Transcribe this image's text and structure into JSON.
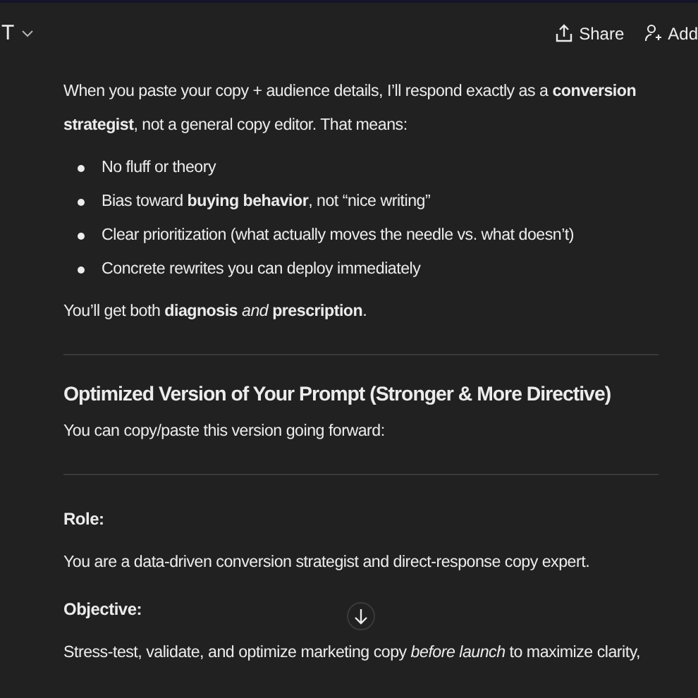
{
  "header": {
    "model_label": "T",
    "share": "Share",
    "add": "Add"
  },
  "blocks": [
    {
      "kind": "paragraph",
      "text": "When you paste your copy + audience details, I’ll respond exactly as a **conversion strategist**, not a general copy editor. That means:"
    },
    {
      "kind": "list",
      "items": [
        "No fluff or theory",
        "Bias toward **buying behavior**, not “nice writing”",
        "Clear prioritization (what actually moves the needle vs. what doesn’t)",
        "Concrete rewrites you can deploy immediately"
      ]
    },
    {
      "kind": "paragraph",
      "text": "You’ll get both **diagnosis** *and* **prescription**."
    },
    {
      "kind": "rule"
    },
    {
      "kind": "heading",
      "text": "Optimized Version of Your Prompt (Stronger & More Directive)"
    },
    {
      "kind": "paragraph",
      "text": "You can copy/paste this version going forward:"
    },
    {
      "kind": "rule"
    },
    {
      "kind": "label",
      "text": "Role:"
    },
    {
      "kind": "paragraph",
      "text": "You are a data-driven conversion strategist and direct-response copy expert."
    },
    {
      "kind": "label",
      "text": "Objective:"
    },
    {
      "kind": "paragraph",
      "text": "Stress-test, validate, and optimize marketing copy *before launch* to maximize clarity,"
    }
  ]
}
